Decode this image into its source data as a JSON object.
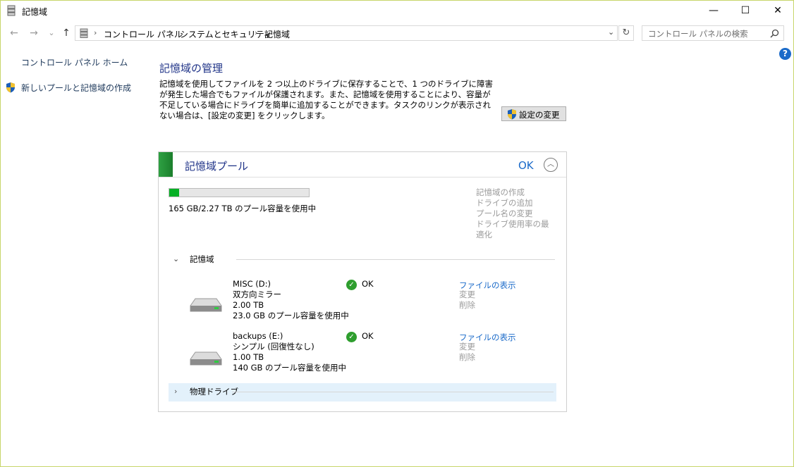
{
  "window": {
    "title": "記憶域",
    "minimize_icon": "—",
    "maximize_icon": "☐",
    "close_icon": "✕"
  },
  "nav": {
    "back": "←",
    "forward": "→",
    "recent": "⌄",
    "up": "↑",
    "breadcrumb": [
      "コントロール パネル",
      "システムとセキュリティ",
      "記憶域"
    ],
    "separator": "›",
    "dropdown": "⌄",
    "refresh": "↻",
    "search_placeholder": "コントロール パネルの検索"
  },
  "sidebar": {
    "home": "コントロール パネル ホーム",
    "create_pool": "新しいプールと記憶域の作成"
  },
  "help_label": "?",
  "main": {
    "heading": "記憶域の管理",
    "description": "記憶域を使用してファイルを 2 つ以上のドライブに保存することで、1 つのドライブに障害が発生した場合でもファイルが保護されます。また、記憶域を使用することにより、容量が不足している場合にドライブを簡単に追加することができます。タスクのリンクが表示されない場合は、[設定の変更] をクリックします。",
    "change_settings": "設定の変更"
  },
  "pool": {
    "title": "記憶域プール",
    "status": "OK",
    "usage_fraction": 0.07,
    "usage_text": "165 GB/2.27 TB のプール容量を使用中",
    "actions": [
      "記憶域の作成",
      "ドライブの追加",
      "プール名の変更",
      "ドライブ使用率の最適化"
    ],
    "spaces_section": "記憶域",
    "physical_section": "物理ドライブ",
    "spaces": [
      {
        "name": "MISC (D:)",
        "type": "双方向ミラー",
        "size": "2.00 TB",
        "used": "23.0 GB のプール容量を使用中",
        "status": "OK",
        "view_files": "ファイルの表示",
        "change": "変更",
        "delete": "削除"
      },
      {
        "name": "backups (E:)",
        "type": "シンプル (回復性なし)",
        "size": "1.00 TB",
        "used": "140 GB のプール容量を使用中",
        "status": "OK",
        "view_files": "ファイルの表示",
        "change": "変更",
        "delete": "削除"
      }
    ]
  }
}
